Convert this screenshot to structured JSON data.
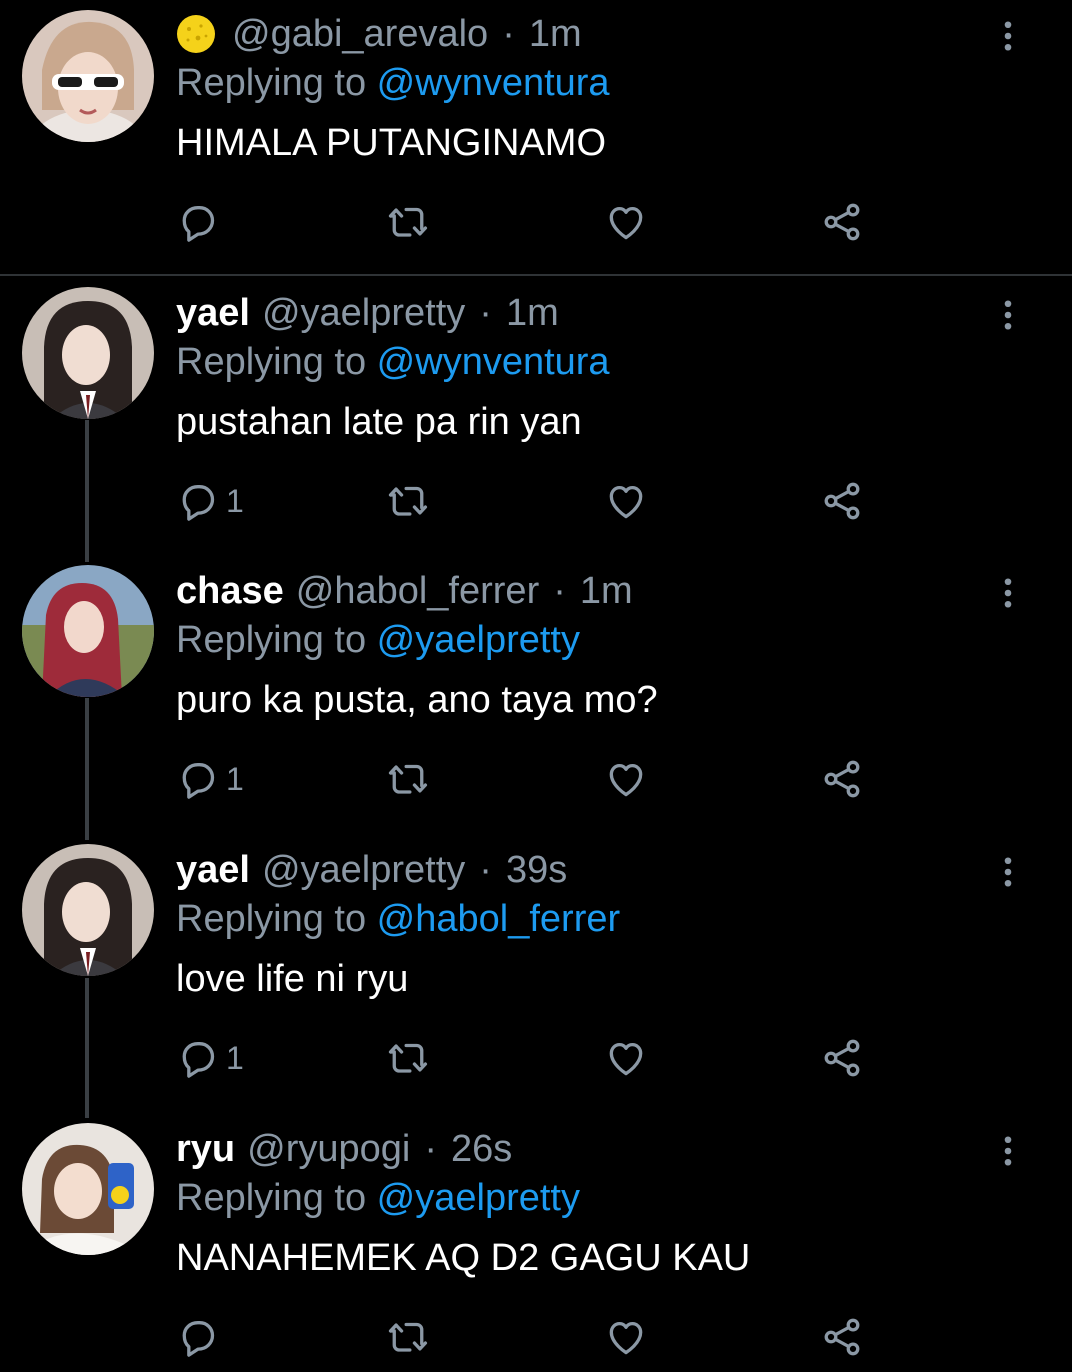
{
  "colors": {
    "background": "#000000",
    "text_primary": "#ffffff",
    "text_secondary": "#8b98a5",
    "mention": "#1d9bf0",
    "thread_line": "#3a3f44"
  },
  "icons": {
    "reply": "reply-icon",
    "retweet": "retweet-icon",
    "like": "heart-icon",
    "share": "share-icon",
    "more": "more-vertical-icon",
    "name_emoji": "yellow-circle-emoji"
  },
  "tweets": [
    {
      "display_name": "",
      "has_name_emoji": true,
      "handle": "@gabi_arevalo",
      "separator": "·",
      "time": "1m",
      "replying_prefix": "Replying to ",
      "replying_to": "@wynventura",
      "text": "HIMALA PUTANGINAMO",
      "reply_count": ""
    },
    {
      "display_name": "yael",
      "has_name_emoji": false,
      "handle": "@yaelpretty",
      "separator": "·",
      "time": "1m",
      "replying_prefix": "Replying to ",
      "replying_to": "@wynventura",
      "text": "pustahan late pa rin yan",
      "reply_count": "1"
    },
    {
      "display_name": "chase",
      "has_name_emoji": false,
      "handle": "@habol_ferrer",
      "separator": "·",
      "time": "1m",
      "replying_prefix": "Replying to ",
      "replying_to": "@yaelpretty",
      "text": "puro ka pusta, ano taya mo?",
      "reply_count": "1"
    },
    {
      "display_name": "yael",
      "has_name_emoji": false,
      "handle": "@yaelpretty",
      "separator": "·",
      "time": "39s",
      "replying_prefix": "Replying to ",
      "replying_to": "@habol_ferrer",
      "text": "love life ni ryu",
      "reply_count": "1"
    },
    {
      "display_name": "ryu",
      "has_name_emoji": false,
      "handle": "@ryupogi",
      "separator": "·",
      "time": "26s",
      "replying_prefix": "Replying to ",
      "replying_to": "@yaelpretty",
      "text": "NANAHEMEK AQ D2 GAGU KAU",
      "reply_count": ""
    }
  ]
}
